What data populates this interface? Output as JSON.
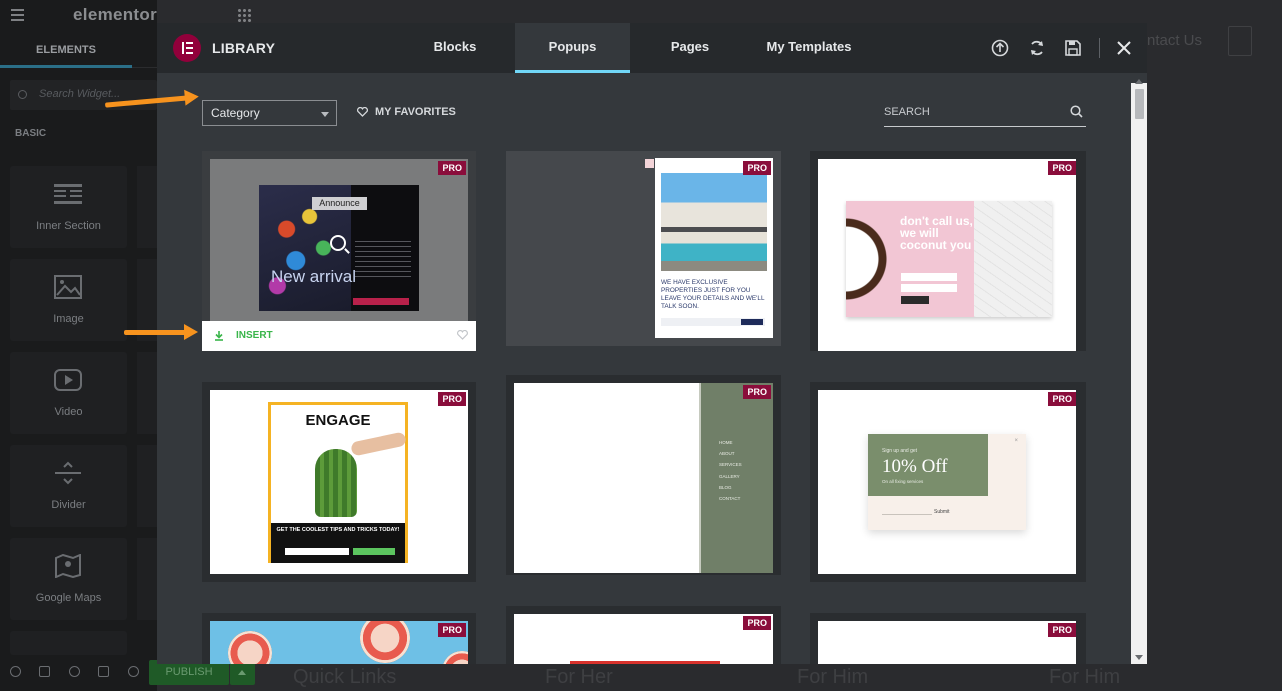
{
  "editor": {
    "brand": "elementor",
    "panel_tab": "ELEMENTS",
    "search_placeholder": "Search Widget...",
    "section": "BASIC",
    "widgets": [
      {
        "label": "Inner Section",
        "icon": "inner-section-icon"
      },
      {
        "label": "Image",
        "icon": "image-icon"
      },
      {
        "label": "Video",
        "icon": "video-icon"
      },
      {
        "label": "Divider",
        "icon": "divider-icon"
      },
      {
        "label": "Google Maps",
        "icon": "map-icon"
      }
    ],
    "publish_label": "PUBLISH"
  },
  "background_page": {
    "contact": "ntact Us",
    "footer": [
      "Quick Links",
      "For Her",
      "For Him",
      "For Him"
    ]
  },
  "library": {
    "title": "LIBRARY",
    "tabs": [
      {
        "label": "Blocks",
        "active": false
      },
      {
        "label": "Popups",
        "active": true
      },
      {
        "label": "Pages",
        "active": false
      },
      {
        "label": "My Templates",
        "active": false
      }
    ],
    "header_icons": [
      "upload-icon",
      "sync-icon",
      "save-icon",
      "close-icon"
    ],
    "category_select": "Category",
    "favorites_label": "MY FAVORITES",
    "search_placeholder": "SEARCH",
    "insert_label": "INSERT",
    "pro_badge": "PRO",
    "templates": {
      "announce": {
        "badge": "Announce",
        "headline": "New arrival"
      },
      "house": {
        "text": "WE HAVE EXCLUSIVE PROPERTIES JUST FOR YOU LEAVE YOUR DETAILS AND WE'LL TALK SOON."
      },
      "coconut": {
        "headline": "don't call us, we will coconut you"
      },
      "engage": {
        "headline": "ENGAGE",
        "cta": "GET THE COOLEST TIPS AND TRICKS TODAY!"
      },
      "menu": {
        "items": [
          "HOME",
          "ABOUT",
          "SERVICES",
          "GALLERY",
          "BLOG",
          "CONTACT"
        ]
      },
      "discount": {
        "small": "Sign up and get",
        "big": "10% Off",
        "sub": "On all fixing services",
        "submit": "Submit"
      }
    }
  },
  "colors": {
    "accent_tab": "#71d7f7",
    "pro_badge": "#8a0d3b",
    "insert_green": "#39b54a",
    "annotation_arrow": "#f7931e",
    "logo": "#92003b"
  }
}
